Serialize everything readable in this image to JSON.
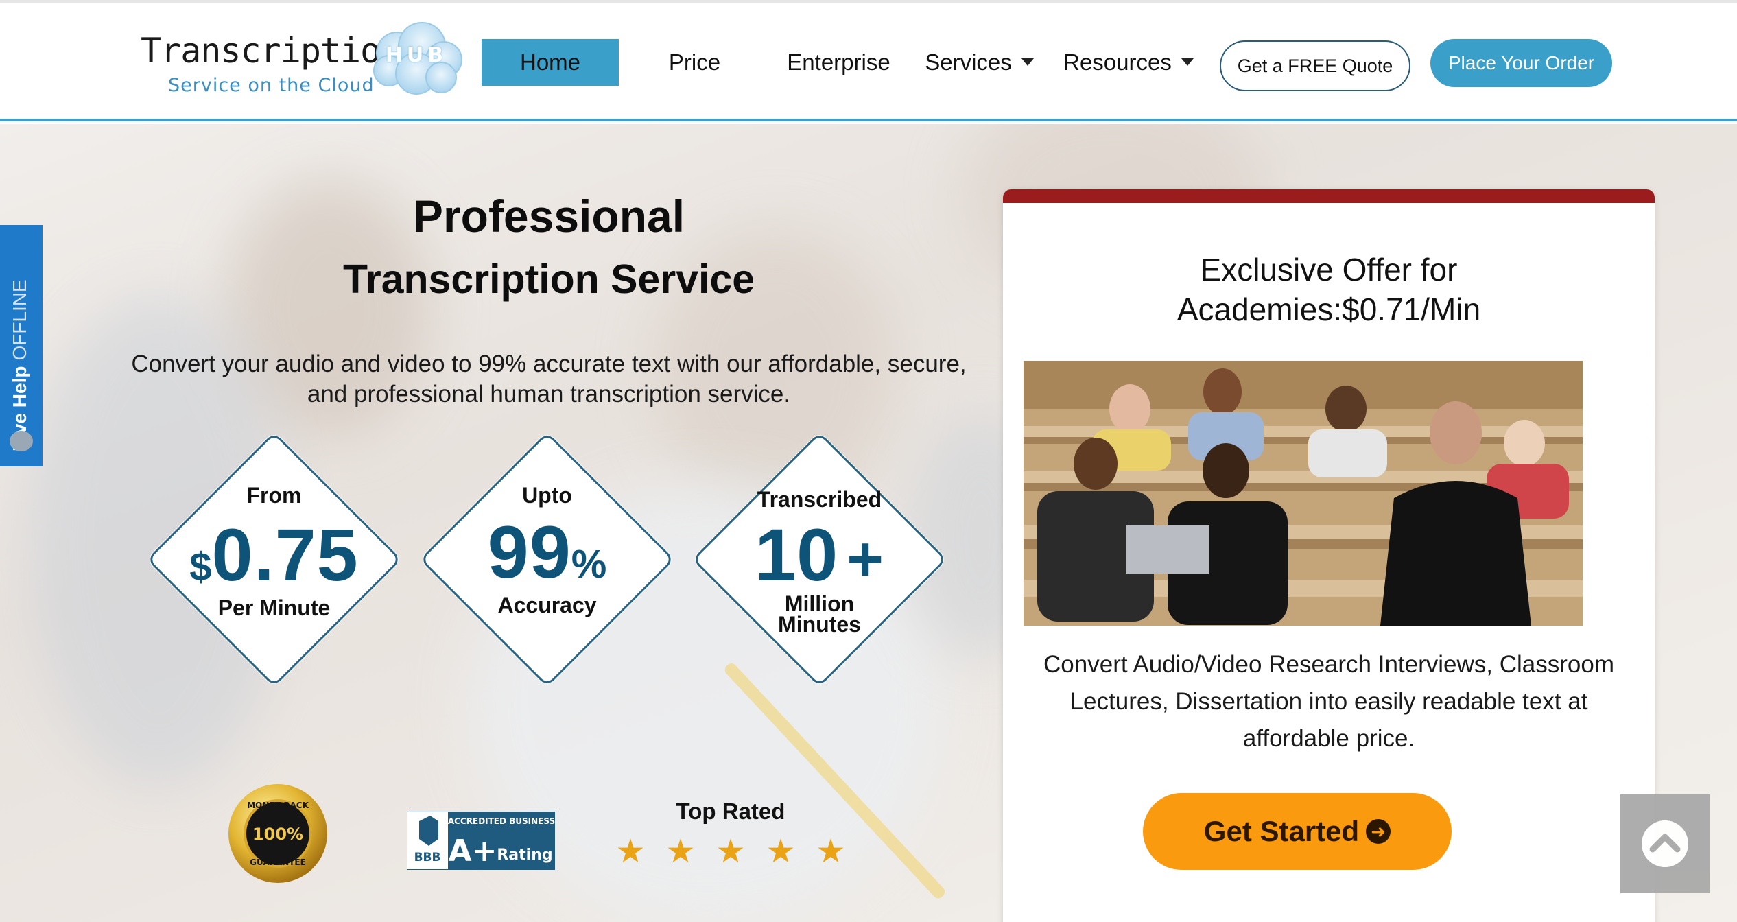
{
  "brand": {
    "logo_word": "Transcription",
    "logo_hub": "HUB",
    "logo_tagline": "Service on the Cloud",
    "primary_color": "#3aa0c9",
    "accent_color": "#0e5378",
    "cta_color": "#fa9a0f",
    "card_top_color": "#9a1c1c"
  },
  "nav": {
    "home": "Home",
    "price": "Price",
    "enterprise": "Enterprise",
    "services": "Services",
    "resources": "Resources",
    "quote_button": "Get a FREE Quote",
    "order_button": "Place Your Order"
  },
  "live_help": {
    "label": "Live Help",
    "status": "OFFLINE"
  },
  "hero": {
    "title_line1": "Professional",
    "title_line2": "Transcription Service",
    "description": "Convert your audio and video to 99% accurate text with our affordable, secure, and professional human transcription service."
  },
  "stats": [
    {
      "top": "From",
      "prefix": "$",
      "value": "0.75",
      "suffix": "",
      "bottom": "Per Minute"
    },
    {
      "top": "Upto",
      "prefix": "",
      "value": "99",
      "suffix": "%",
      "bottom": "Accuracy"
    },
    {
      "top": "Transcribed",
      "prefix": "",
      "value": "10",
      "suffix": "+",
      "bottom_line1": "Million",
      "bottom_line2": "Minutes"
    }
  ],
  "badges": {
    "money_back_line1": "MONEY BACK",
    "money_back_pct": "100%",
    "money_back_line2": "GUARANTEE",
    "bbb_header": "ACCREDITED BUSINESS",
    "bbb_logo": "BBB",
    "bbb_grade": "A+",
    "bbb_rating": "Rating",
    "top_rated": "Top Rated",
    "stars": 5
  },
  "offer": {
    "title_line1": "Exclusive Offer for",
    "title_line2": "Academies:$0.71/Min",
    "text": "Convert Audio/Video Research Interviews, Classroom Lectures, Dissertation into easily readable text at affordable price.",
    "cta": "Get Started"
  },
  "icons": {
    "scroll_top": "chevron-up-icon",
    "cta_arrow": "arrow-right-circle-icon",
    "chat": "chat-bubble-icon"
  }
}
